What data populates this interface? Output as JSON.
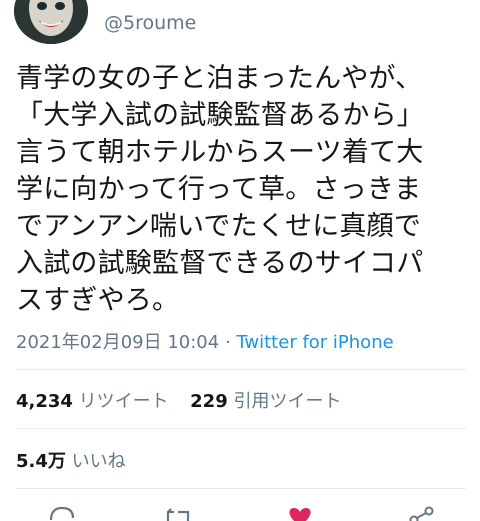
{
  "user": {
    "handle": "@5roume"
  },
  "tweet": {
    "lines": [
      "青学の女の子と泊まったんやが、",
      "「大学入試の試験監督あるから」",
      "言うて朝ホテルからスーツ着て大",
      "学に向かって行って草。さっきま",
      "でアンアン喘いでたくせに真顔で",
      "入試の試験監督できるのサイコパ",
      "スすぎやろ。"
    ],
    "timestamp": "2021年02月09日 10:04",
    "separator": " · ",
    "source": "Twitter for iPhone"
  },
  "stats": {
    "retweets_count": "4,234",
    "retweets_label": "リツイート",
    "quotes_count": "229",
    "quotes_label": "引用ツイート",
    "likes_count": "5.4万",
    "likes_label": "いいね"
  },
  "actions": [
    {
      "name": "reply",
      "icon": "reply-icon"
    },
    {
      "name": "retweet",
      "icon": "retweet-icon"
    },
    {
      "name": "like",
      "icon": "heart-icon",
      "color": "#e0245e"
    },
    {
      "name": "share",
      "icon": "share-icon"
    }
  ]
}
